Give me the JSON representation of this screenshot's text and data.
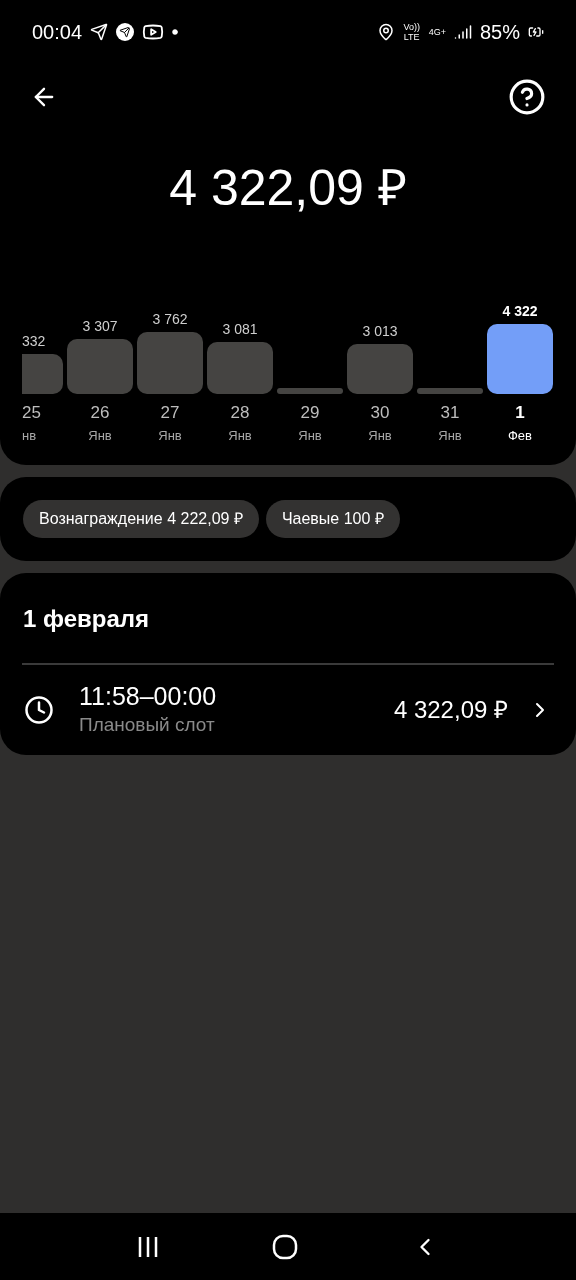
{
  "status_bar": {
    "time": "00:04",
    "network": [
      "Vo))",
      "LTE",
      "4G+"
    ],
    "battery": "85%"
  },
  "total": "4 322,09 ₽",
  "days": [
    {
      "value": "332",
      "day": "25",
      "month": "нв",
      "selected": false
    },
    {
      "value": "3 307",
      "day": "26",
      "month": "Янв",
      "selected": false
    },
    {
      "value": "3 762",
      "day": "27",
      "month": "Янв",
      "selected": false
    },
    {
      "value": "3 081",
      "day": "28",
      "month": "Янв",
      "selected": false
    },
    {
      "day": "29",
      "month": "Янв",
      "selected": false
    },
    {
      "value": "3 013",
      "day": "30",
      "month": "Янв",
      "selected": false
    },
    {
      "day": "31",
      "month": "Янв",
      "selected": false
    },
    {
      "value": "4 322",
      "day": "1",
      "month": "Фев",
      "selected": true
    }
  ],
  "chips": [
    "Вознаграждение 4 222,09 ₽",
    "Чаевые 100 ₽"
  ],
  "section": {
    "title": "1 февраля",
    "slots": [
      {
        "time": "11:58–00:00",
        "type": "Плановый слот",
        "amount": "4 322,09 ₽"
      }
    ]
  }
}
